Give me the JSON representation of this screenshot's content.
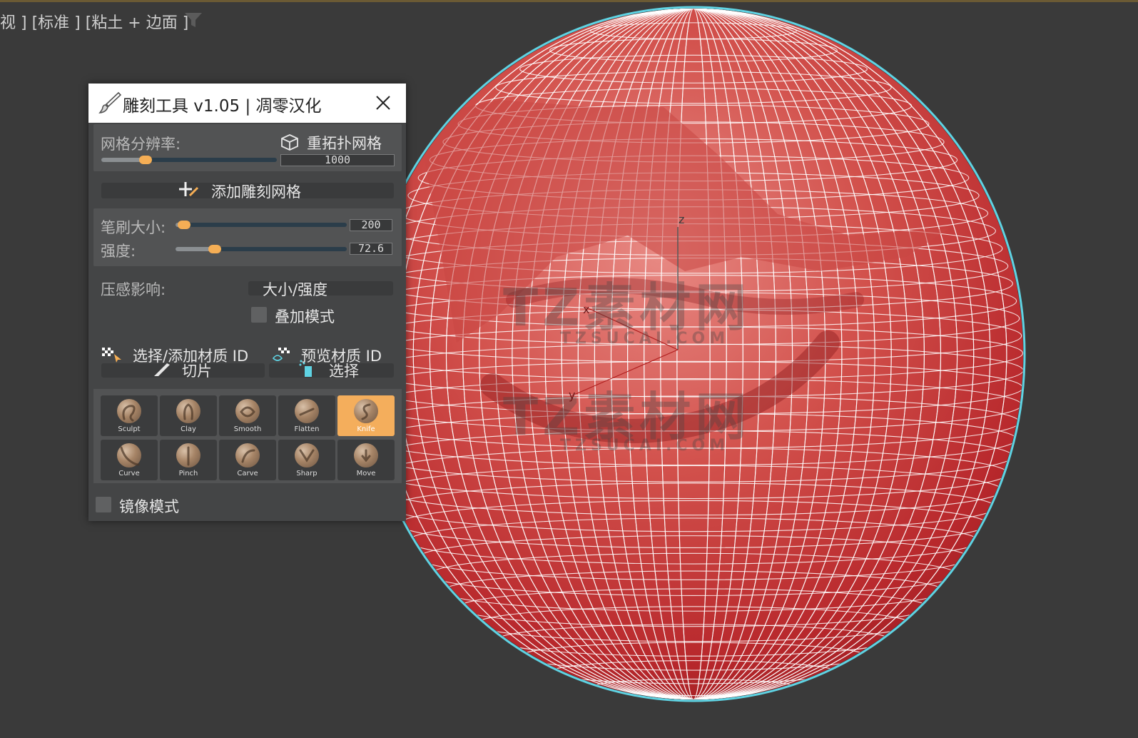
{
  "viewport": {
    "label": "视 ] [标准 ] [粘土 + 边面 ]",
    "watermark_main": "TZ素材网",
    "watermark_sub": "TZSUCAI.COM",
    "axes": {
      "z": "z",
      "x": "x",
      "y": "y"
    },
    "mesh_color": "#d24a4a",
    "wire_color": "#ffffff",
    "outline_color": "#5fd3e3"
  },
  "panel": {
    "title": "雕刻工具 v1.05 | 凋零汉化",
    "resolution": {
      "label": "网格分辨率:",
      "retopo_label": "重拓扑网格",
      "value_text": "1000",
      "slider_level": 0.25
    },
    "add_mesh_label": "添加雕刻网格",
    "brush_size": {
      "label": "笔刷大小:",
      "value_text": "200",
      "slider_level": 0.05
    },
    "strength": {
      "label": "强度:",
      "value_text": "72.6",
      "slider_level": 0.23
    },
    "pressure": {
      "label": "压感影响:",
      "value": "大小/强度"
    },
    "additive": {
      "label": "叠加模式",
      "checked": false
    },
    "material": {
      "select_label": "选择/添加材质 ID",
      "preview_label": "预览材质 ID"
    },
    "slice_label": "切片",
    "select_label": "选择",
    "brushes": [
      {
        "name": "Sculpt",
        "active": false
      },
      {
        "name": "Clay",
        "active": false
      },
      {
        "name": "Smooth",
        "active": false
      },
      {
        "name": "Flatten",
        "active": false
      },
      {
        "name": "Knife",
        "active": true
      },
      {
        "name": "Curve",
        "active": false
      },
      {
        "name": "Pinch",
        "active": false
      },
      {
        "name": "Carve",
        "active": false
      },
      {
        "name": "Sharp",
        "active": false
      },
      {
        "name": "Move",
        "active": false
      }
    ],
    "mirror": {
      "label": "镜像模式",
      "checked": false
    },
    "accent_color": "#f5ae55"
  }
}
